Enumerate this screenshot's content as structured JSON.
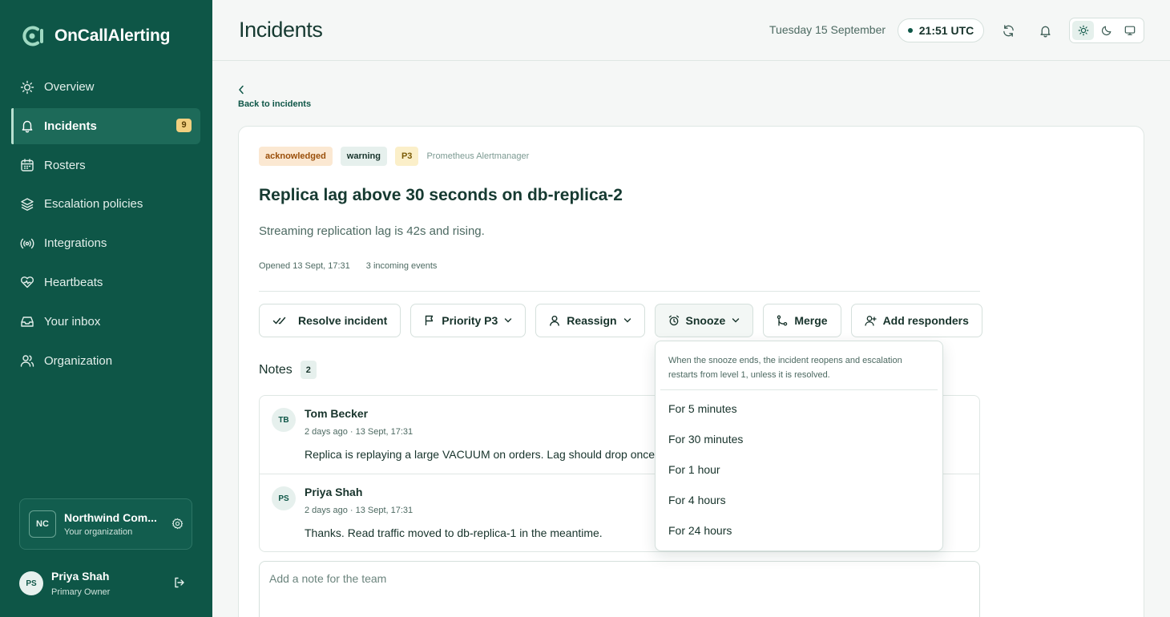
{
  "app": {
    "name": "OnCallAlerting"
  },
  "sidebar": {
    "items": [
      {
        "label": "Overview",
        "icon": "sun-icon"
      },
      {
        "label": "Incidents",
        "icon": "bell-icon",
        "badge": "9",
        "active": true
      },
      {
        "label": "Rosters",
        "icon": "calendar-icon"
      },
      {
        "label": "Escalation policies",
        "icon": "layers-icon"
      },
      {
        "label": "Integrations",
        "icon": "broadcast-icon"
      },
      {
        "label": "Heartbeats",
        "icon": "heartbeat-icon"
      },
      {
        "label": "Your inbox",
        "icon": "inbox-icon"
      },
      {
        "label": "Organization",
        "icon": "users-icon"
      }
    ],
    "org": {
      "initials": "NC",
      "name": "Northwind Com...",
      "subtitle": "Your organization"
    },
    "user": {
      "initials": "PS",
      "name": "Priya Shah",
      "role": "Primary Owner"
    }
  },
  "header": {
    "title": "Incidents",
    "date": "Tuesday 15 September",
    "time": "21:51 UTC"
  },
  "back_link": "Back to incidents",
  "incident": {
    "chips": {
      "status": "acknowledged",
      "severity": "warning",
      "priority": "P3",
      "source": "Prometheus Alertmanager"
    },
    "title": "Replica lag above 30 seconds on db-replica-2",
    "description": "Streaming replication lag is 42s and rising.",
    "opened": "Opened 13 Sept, 17:31",
    "events": "3 incoming events"
  },
  "actions": {
    "resolve": "Resolve incident",
    "priority": "Priority P3",
    "reassign": "Reassign",
    "snooze": "Snooze",
    "merge": "Merge",
    "add_responders": "Add responders"
  },
  "notes": {
    "title": "Notes",
    "count": "2",
    "items": [
      {
        "initials": "TB",
        "author": "Tom Becker",
        "time": "2 days ago · 13 Sept, 17:31",
        "text": "Replica is replaying a large VACUUM on orders. Lag should drop once it finishes."
      },
      {
        "initials": "PS",
        "author": "Priya Shah",
        "time": "2 days ago · 13 Sept, 17:31",
        "text": "Thanks. Read traffic moved to db-replica-1 in the meantime."
      }
    ],
    "placeholder": "Add a note for the team"
  },
  "snooze_menu": {
    "note": "When the snooze ends, the incident reopens and escalation restarts from level 1, unless it is resolved.",
    "options": [
      "For 5 minutes",
      "For 30 minutes",
      "For 1 hour",
      "For 4 hours",
      "For 24 hours"
    ]
  },
  "colors": {
    "sidebar": "#0e5647",
    "accent": "#0e5647",
    "badge": "#f2cf7f"
  }
}
